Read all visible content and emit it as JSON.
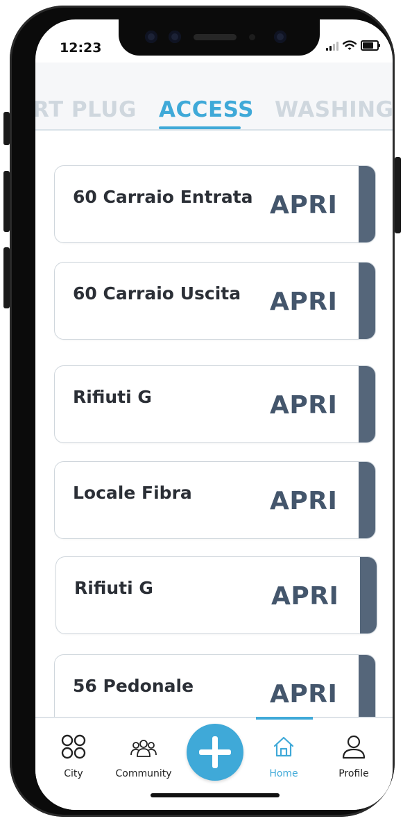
{
  "status_bar": {
    "time": "12:23"
  },
  "tabs": [
    {
      "label": "RT PLUG",
      "active": false
    },
    {
      "label": "ACCESS",
      "active": true
    },
    {
      "label": "WASHING M",
      "active": false
    }
  ],
  "access_items": [
    {
      "name": "60 Carraio Entrata",
      "action": "APRI"
    },
    {
      "name": "60 Carraio Uscita",
      "action": "APRI"
    },
    {
      "name": "Rifiuti G",
      "action": "APRI"
    },
    {
      "name": "Locale Fibra",
      "action": "APRI"
    },
    {
      "name": "Rifiuti G",
      "action": "APRI"
    },
    {
      "name": "56 Pedonale",
      "action": "APRI"
    }
  ],
  "bottom_nav": {
    "city": "City",
    "community": "Community",
    "home": "Home",
    "profile": "Profile",
    "add_icon": "plus-icon"
  },
  "colors": {
    "accent": "#3fa9d8",
    "card_strip": "#55667a",
    "action_text": "#44566c",
    "inactive_tab": "#cfd7de"
  }
}
